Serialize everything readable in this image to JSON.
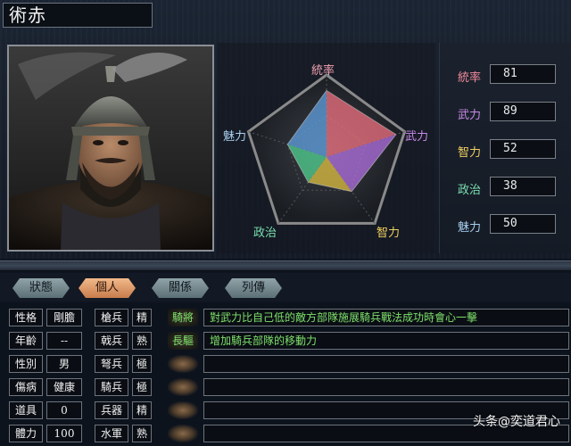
{
  "general": {
    "name": "術赤"
  },
  "radar": {
    "labels": {
      "command": "統率",
      "war": "武力",
      "intelligence": "智力",
      "politics": "政治",
      "charisma": "魅力"
    },
    "values": {
      "command": 81,
      "war": 89,
      "intelligence": 52,
      "politics": 38,
      "charisma": 50
    }
  },
  "stats": [
    {
      "label": "統率",
      "value": "81",
      "color": "#f08a9a"
    },
    {
      "label": "武力",
      "value": "89",
      "color": "#c98ae8"
    },
    {
      "label": "智力",
      "value": "52",
      "color": "#f0d060"
    },
    {
      "label": "政治",
      "value": "38",
      "color": "#7ae0b0"
    },
    {
      "label": "魅力",
      "value": "50",
      "color": "#a8d0f0"
    }
  ],
  "tabs": [
    {
      "label": "狀態",
      "active": false
    },
    {
      "label": "個人",
      "active": true
    },
    {
      "label": "關係",
      "active": false
    },
    {
      "label": "列傳",
      "active": false
    }
  ],
  "attributes": [
    {
      "label": "性格",
      "value": "剛膽"
    },
    {
      "label": "年齡",
      "value": "--"
    },
    {
      "label": "性別",
      "value": "男"
    },
    {
      "label": "傷病",
      "value": "健康"
    },
    {
      "label": "道具",
      "value": "0"
    },
    {
      "label": "體力",
      "value": "100"
    }
  ],
  "aptitudes": [
    {
      "label": "槍兵",
      "value": "精"
    },
    {
      "label": "戟兵",
      "value": "熟"
    },
    {
      "label": "弩兵",
      "value": "極"
    },
    {
      "label": "騎兵",
      "value": "極"
    },
    {
      "label": "兵器",
      "value": "精"
    },
    {
      "label": "水軍",
      "value": "熟"
    }
  ],
  "skills": [
    {
      "name": "騎將",
      "desc": "對武力比自己低的敵方部隊施展騎兵戰法成功時會心一擊"
    },
    {
      "name": "長驅",
      "desc": "增加騎兵部隊的移動力"
    },
    {
      "name": "",
      "desc": ""
    },
    {
      "name": "",
      "desc": ""
    },
    {
      "name": "",
      "desc": ""
    },
    {
      "name": "",
      "desc": ""
    }
  ],
  "watermark": "头条@奕道君心"
}
